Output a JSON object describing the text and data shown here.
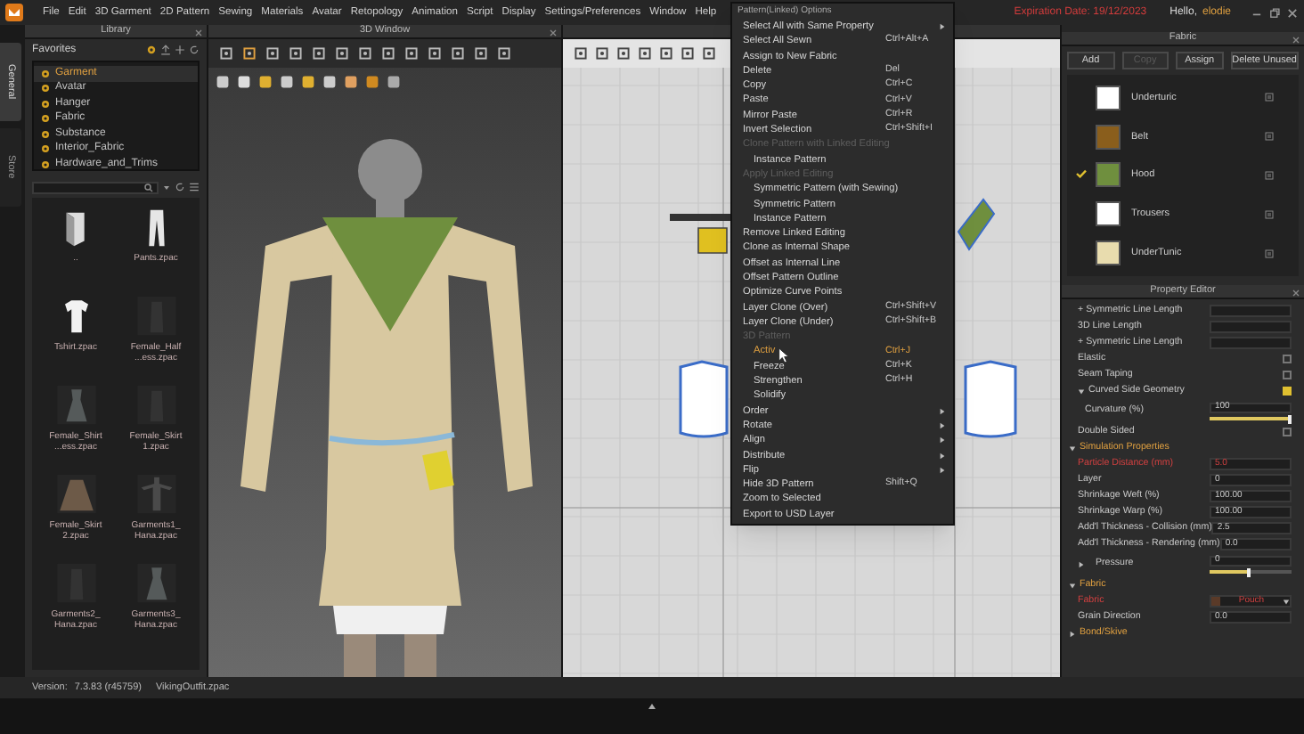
{
  "menu_bar": {
    "items": [
      "File",
      "Edit",
      "3D Garment",
      "2D Pattern",
      "Sewing",
      "Materials",
      "Avatar",
      "Retopology",
      "Animation",
      "Script",
      "Display",
      "Settings/Preferences",
      "Window",
      "Help"
    ],
    "expiration": "Expiration Date: 19/12/2023",
    "greeting": "Hello,",
    "user": "elodie"
  },
  "side_tabs": [
    {
      "label": "General",
      "selected": true
    },
    {
      "label": "Store",
      "selected": false
    }
  ],
  "library": {
    "title": "Library",
    "favorites_label": "Favorites",
    "tree": [
      {
        "label": "Garment",
        "selected": true
      },
      {
        "label": "Avatar",
        "selected": false
      },
      {
        "label": "Hanger",
        "selected": false
      },
      {
        "label": "Fabric",
        "selected": false
      },
      {
        "label": "Substance",
        "selected": false
      },
      {
        "label": "Interior_Fabric",
        "selected": false
      },
      {
        "label": "Hardware_and_Trims",
        "selected": false
      }
    ],
    "files": [
      {
        "name": "..",
        "kind": "folder"
      },
      {
        "name": "Pants.zpac",
        "kind": "pants"
      },
      {
        "name": "Tshirt.zpac",
        "kind": "shirt"
      },
      {
        "name": "Female_Half ...ess.zpac",
        "kind": "dark"
      },
      {
        "name": "Female_Shirt ...ess.zpac",
        "kind": "dress"
      },
      {
        "name": "Female_Skirt 1.zpac",
        "kind": "dark"
      },
      {
        "name": "Female_Skirt 2.zpac",
        "kind": "skirt"
      },
      {
        "name": "Garments1_ Hana.zpac",
        "kind": "suit"
      },
      {
        "name": "Garments2_ Hana.zpac",
        "kind": "dark"
      },
      {
        "name": "Garments3_ Hana.zpac",
        "kind": "dress"
      }
    ]
  },
  "window_3d": {
    "title": "3D Window"
  },
  "window_2d": {
    "context_menu": {
      "title": "Pattern(Linked) Options",
      "items": [
        {
          "label": "Select All with Same Property",
          "kind": "item",
          "submenu": true,
          "selected": false
        },
        {
          "label": "Select All Sewn",
          "shortcut": "Ctrl+Alt+A",
          "kind": "item",
          "selected": false
        },
        {
          "label": "Assign to New Fabric",
          "kind": "item",
          "selected": false
        },
        {
          "label": "Delete",
          "shortcut": "Del",
          "kind": "item",
          "selected": false
        },
        {
          "label": "Copy",
          "shortcut": "Ctrl+C",
          "kind": "item",
          "selected": false
        },
        {
          "label": "Paste",
          "shortcut": "Ctrl+V",
          "kind": "item",
          "selected": false
        },
        {
          "label": "Mirror Paste",
          "shortcut": "Ctrl+R",
          "kind": "item",
          "selected": false
        },
        {
          "label": "Invert Selection",
          "shortcut": "Ctrl+Shift+I",
          "kind": "item",
          "selected": false
        },
        {
          "label": "Clone Pattern with Linked Editing",
          "kind": "heading"
        },
        {
          "label": "Instance Pattern",
          "kind": "sub",
          "selected": false
        },
        {
          "label": "Apply Linked Editing",
          "kind": "heading"
        },
        {
          "label": "Symmetric Pattern (with Sewing)",
          "kind": "sub",
          "selected": false
        },
        {
          "label": "Symmetric Pattern",
          "kind": "sub",
          "selected": false
        },
        {
          "label": "Instance Pattern",
          "kind": "sub",
          "selected": false
        },
        {
          "label": "Remove Linked Editing",
          "kind": "item",
          "selected": false
        },
        {
          "label": "Clone as Internal Shape",
          "kind": "item",
          "selected": false
        },
        {
          "label": "Offset as Internal Line",
          "kind": "item",
          "selected": false
        },
        {
          "label": "Offset Pattern Outline",
          "kind": "item",
          "selected": false
        },
        {
          "label": "Optimize Curve Points",
          "kind": "item",
          "selected": false
        },
        {
          "label": "Layer Clone (Over)",
          "shortcut": "Ctrl+Shift+V",
          "kind": "item",
          "selected": false
        },
        {
          "label": "Layer Clone (Under)",
          "shortcut": "Ctrl+Shift+B",
          "kind": "item",
          "selected": false
        },
        {
          "label": "3D Pattern",
          "kind": "heading"
        },
        {
          "label": "Activ",
          "shortcut": "Ctrl+J",
          "kind": "sub",
          "selected": true
        },
        {
          "label": "Freeze",
          "shortcut": "Ctrl+K",
          "kind": "sub",
          "selected": false
        },
        {
          "label": "Strengthen",
          "shortcut": "Ctrl+H",
          "kind": "sub",
          "selected": false
        },
        {
          "label": "Solidify",
          "kind": "sub",
          "selected": false
        },
        {
          "label": "Order",
          "kind": "item",
          "submenu": true,
          "selected": false
        },
        {
          "label": "Rotate",
          "kind": "item",
          "submenu": true,
          "selected": false
        },
        {
          "label": "Align",
          "kind": "item",
          "submenu": true,
          "selected": false
        },
        {
          "label": "Distribute",
          "kind": "item",
          "submenu": true,
          "selected": false
        },
        {
          "label": "Flip",
          "kind": "item",
          "submenu": true,
          "selected": false
        },
        {
          "label": "Hide 3D Pattern",
          "shortcut": "Shift+Q",
          "kind": "item",
          "selected": false
        },
        {
          "label": "Zoom to Selected",
          "kind": "item",
          "selected": false
        },
        {
          "label": "Export to USD Layer",
          "kind": "item",
          "selected": false
        }
      ]
    }
  },
  "fabric_panel": {
    "title": "Fabric",
    "buttons": [
      {
        "label": "Add",
        "disabled": false
      },
      {
        "label": "Copy",
        "disabled": true
      },
      {
        "label": "Assign",
        "disabled": false
      },
      {
        "label": "Delete Unused",
        "disabled": false
      }
    ],
    "fabrics": [
      {
        "name": "Underturic",
        "color": "#ffffff",
        "selected": false
      },
      {
        "name": "Belt",
        "color": "#8a5e1c",
        "selected": false
      },
      {
        "name": "Hood",
        "color": "#6f8f3e",
        "selected": true
      },
      {
        "name": "Trousers",
        "color": "#ffffff",
        "selected": false
      },
      {
        "name": "UnderTunic",
        "color": "#e8dcae",
        "selected": false
      }
    ]
  },
  "property_editor": {
    "title": "Property Editor",
    "rows": [
      {
        "kind": "field",
        "label": "+ Symmetric Line Length"
      },
      {
        "kind": "field",
        "label": "3D Line Length"
      },
      {
        "kind": "field",
        "label": "+ Symmetric Line Length"
      },
      {
        "kind": "check",
        "label": "Elastic",
        "checked": false
      },
      {
        "kind": "check",
        "label": "Seam Taping",
        "checked": false
      },
      {
        "kind": "group",
        "label": "Curved Side Geometry",
        "expanded": true,
        "checked": true
      },
      {
        "kind": "slider",
        "label": "Curvature (%)",
        "value": "100",
        "level": 1
      },
      {
        "kind": "check",
        "label": "Double Sided",
        "checked": false
      },
      {
        "kind": "section",
        "label": "Simulation Properties",
        "expanded": true
      },
      {
        "kind": "field",
        "label": "Particle Distance (mm)",
        "value": "5.0",
        "alert": true
      },
      {
        "kind": "field",
        "label": "Layer",
        "value": "0"
      },
      {
        "kind": "field",
        "label": "Shrinkage Weft (%)",
        "value": "100.00"
      },
      {
        "kind": "field",
        "label": "Shrinkage Warp (%)",
        "value": "100.00"
      },
      {
        "kind": "field",
        "label": "Add'l Thickness - Collision (mm)",
        "value": "2.5"
      },
      {
        "kind": "field",
        "label": "Add'l Thickness - Rendering (mm)",
        "value": "0.0"
      },
      {
        "kind": "slider",
        "label": "Pressure",
        "value": "0",
        "level": 0.5,
        "expanded": false
      },
      {
        "kind": "section",
        "label": "Fabric",
        "expanded": true
      },
      {
        "kind": "dropdown",
        "label": "Fabric",
        "value": "Pouch",
        "alert": true
      },
      {
        "kind": "field",
        "label": "Grain Direction",
        "value": "0.0"
      },
      {
        "kind": "section",
        "label": "Bond/Skive",
        "expanded": false
      }
    ]
  },
  "status_bar": {
    "version_label": "Version:",
    "version": "7.3.83 (r45759)",
    "file": "VikingOutfit.zpac"
  }
}
